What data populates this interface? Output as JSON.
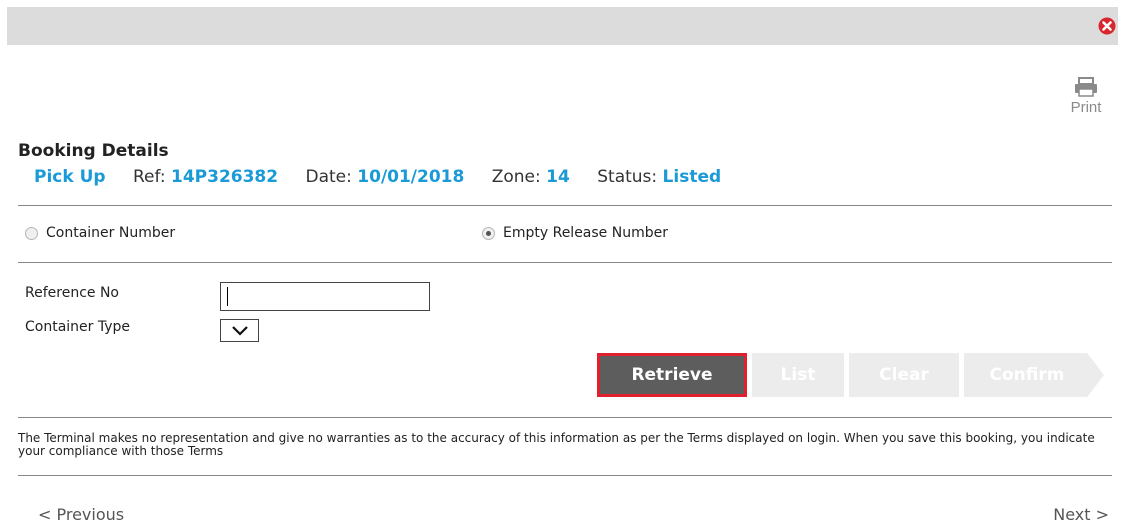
{
  "window": {
    "close_icon": "close-circle-icon",
    "close_color": "#d9262c"
  },
  "print": {
    "label": "Print",
    "icon": "printer-icon"
  },
  "booking": {
    "heading": "Booking Details",
    "type": "Pick Up",
    "ref_label": "Ref:",
    "ref_value": "14P326382",
    "date_label": "Date:",
    "date_value": "10/01/2018",
    "zone_label": "Zone:",
    "zone_value": "14",
    "status_label": "Status:",
    "status_value": "Listed",
    "value_color": "#1a9ad6"
  },
  "search_mode": {
    "options": [
      {
        "label": "Container Number",
        "selected": false
      },
      {
        "label": "Empty Release Number",
        "selected": true
      }
    ]
  },
  "form": {
    "reference_label": "Reference No",
    "reference_value": "",
    "container_type_label": "Container Type",
    "container_type_value": ""
  },
  "actions": {
    "retrieve": "Retrieve",
    "list": "List",
    "clear": "Clear",
    "confirm": "Confirm",
    "highlight_color": "#e0202c"
  },
  "disclaimer": "The Terminal makes no representation and give no warranties as to the accuracy of this information as per the Terms displayed on login. When you save this booking, you indicate your compliance with those Terms",
  "pager": {
    "previous": "< Previous",
    "next": "Next >"
  }
}
